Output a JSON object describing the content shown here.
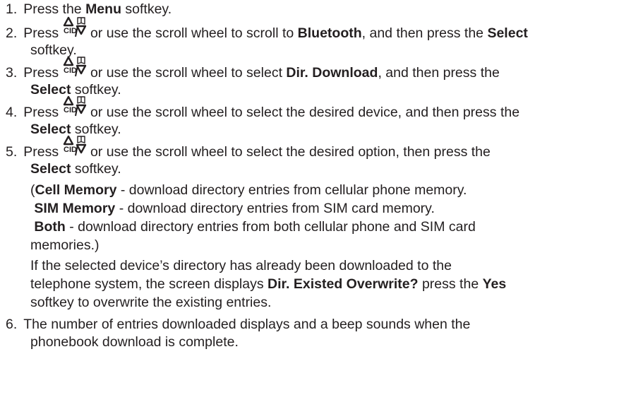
{
  "steps": [
    {
      "number": "1.",
      "text_a": "Press the ",
      "bold_a": "Menu",
      "text_b": " softkey."
    },
    {
      "number": "2.",
      "press": "Press ",
      "text_a": " or use the scroll wheel to scroll to ",
      "bold_a": "Bluetooth",
      "text_b": ", and then press the ",
      "bold_b": "Select",
      "line2": "softkey."
    },
    {
      "number": "3.",
      "press": "Press ",
      "text_a": " or use the scroll wheel to select ",
      "bold_a": "Dir. Download",
      "text_b": ", and then press the",
      "bold_b": "Select",
      "line2": " softkey."
    },
    {
      "number": "4.",
      "press": "Press ",
      "text_a": " or use the scroll wheel to select the desired device, and then press the",
      "bold_b": "Select",
      "line2": " softkey."
    },
    {
      "number": "5.",
      "press": "Press ",
      "text_a": " or use the scroll wheel to select the desired option, then press the",
      "bold_b": "Select",
      "line2": " softkey.",
      "options": [
        {
          "prefix": "(",
          "bold": "Cell Memory",
          "text": " - download directory entries from cellular phone memory."
        },
        {
          "prefix": " ",
          "bold": "SIM Memory",
          "text": " - download directory entries from SIM card memory."
        },
        {
          "prefix": " ",
          "bold": "Both",
          "text": " - download directory entries from both cellular phone and SIM card"
        }
      ],
      "options_end": "memories.)",
      "note_line1": "If the selected device’s directory has already been downloaded to the",
      "note_line2_text": "telephone system, the screen displays ",
      "note_line2_bold": "Dir. Existed Overwrite?",
      "note_line2_text_b": " press the ",
      "note_line2_bold_b": "Yes",
      "note_line3": "softkey to overwrite the existing entries."
    },
    {
      "number": "6.",
      "line1": "The number of entries downloaded displays and a beep sounds when the",
      "line2": "phonebook download is complete."
    }
  ],
  "icon": {
    "name": "cid-directory-scroll-icon",
    "label_left": "CID",
    "separator": "/"
  },
  "colors": {
    "text": "#231f20",
    "background": "#ffffff"
  }
}
